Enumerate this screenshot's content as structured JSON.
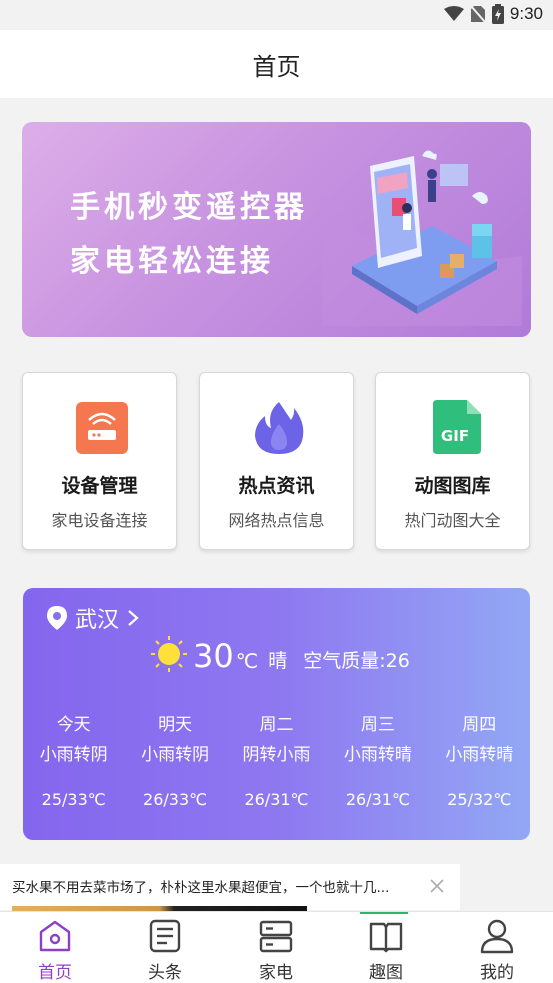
{
  "status_bar": {
    "time": "9:30"
  },
  "header": {
    "title": "首页"
  },
  "banner": {
    "line1": "手机秒变遥控器",
    "line2": "家电轻松连接"
  },
  "features": [
    {
      "title": "设备管理",
      "subtitle": "家电设备连接",
      "icon": "router-icon"
    },
    {
      "title": "热点资讯",
      "subtitle": "网络热点信息",
      "icon": "flame-icon"
    },
    {
      "title": "动图图库",
      "subtitle": "热门动图大全",
      "icon": "gif-icon",
      "icon_text": "GIF"
    }
  ],
  "weather": {
    "city": "武汉",
    "temp": "30",
    "unit": "℃",
    "condition": "晴",
    "aqi_label": "空气质量:",
    "aqi_value": "26",
    "forecast": [
      {
        "day": "今天",
        "cond": "小雨转阴",
        "range": "25/33℃"
      },
      {
        "day": "明天",
        "cond": "小雨转阴",
        "range": "26/33℃"
      },
      {
        "day": "周二",
        "cond": "阴转小雨",
        "range": "26/31℃"
      },
      {
        "day": "周三",
        "cond": "小雨转晴",
        "range": "26/31℃"
      },
      {
        "day": "周四",
        "cond": "小雨转晴",
        "range": "25/32℃"
      }
    ]
  },
  "ad": {
    "text": "买水果不用去菜市场了，朴朴这里水果超便宜，一个也就十几..."
  },
  "tabs": [
    {
      "label": "首页",
      "icon": "home-icon",
      "active": true
    },
    {
      "label": "头条",
      "icon": "news-icon",
      "active": false
    },
    {
      "label": "家电",
      "icon": "appliance-icon",
      "active": false
    },
    {
      "label": "趣图",
      "icon": "book-icon",
      "active": false
    },
    {
      "label": "我的",
      "icon": "user-icon",
      "active": false
    }
  ],
  "colors": {
    "accent": "#8e3fc8",
    "weather_start": "#8466ee",
    "weather_end": "#93a7f5"
  }
}
